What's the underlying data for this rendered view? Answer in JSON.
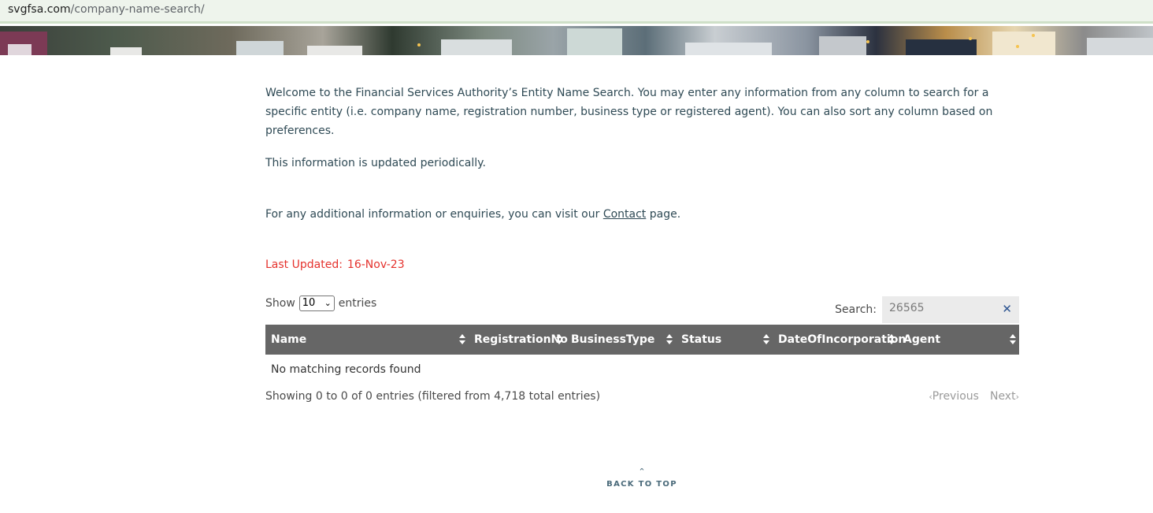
{
  "browser": {
    "url_domain": "svgfsa.com",
    "url_path": "/company-name-search/"
  },
  "intro": {
    "paragraph1": "Welcome to the Financial Services Authority’s Entity Name Search. You may enter any information from any column to search for a specific entity (i.e. company name, registration number, business type or registered agent). You can also sort any column based on preferences.",
    "paragraph2": "This information is updated periodically.",
    "paragraph3_before": "For any additional information or enquiries, you can visit our ",
    "paragraph3_link": "Contact",
    "paragraph3_after": " page."
  },
  "last_updated": {
    "label": "Last Updated:",
    "value": "16-Nov-23"
  },
  "table_controls": {
    "show_label": "Show",
    "page_length": "10",
    "entries_label": "entries",
    "search_label": "Search:",
    "search_value": "26565",
    "clear_glyph": "✕"
  },
  "table": {
    "columns": [
      "Name",
      "RegistrationNo",
      "BusinessType",
      "Status",
      "DateOfIncorporation",
      "Agent"
    ],
    "empty_message": "No matching records found",
    "info": "Showing 0 to 0 of 0 entries (filtered from 4,718 total entries)",
    "prev_label": "Previous",
    "next_label": "Next"
  },
  "footer": {
    "back_to_top": "BACK TO TOP"
  },
  "colors": {
    "text": "#2f4a55",
    "updated": "#e5322d",
    "table_header": "#666666",
    "clear_icon": "#2e5591"
  }
}
